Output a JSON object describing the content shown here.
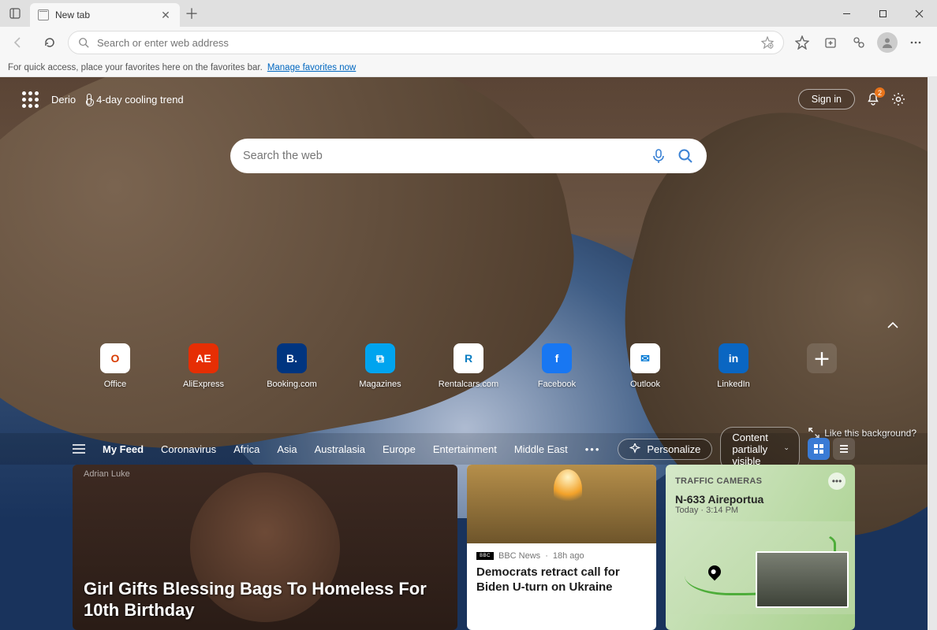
{
  "tab": {
    "title": "New tab"
  },
  "addressbar": {
    "placeholder": "Search or enter web address"
  },
  "favorites_bar": {
    "hint": "For quick access, place your favorites here on the favorites bar.",
    "link": "Manage favorites now"
  },
  "ntp_header": {
    "location": "Derio",
    "weather": "4-day cooling trend",
    "signin": "Sign in",
    "notification_count": "2"
  },
  "ntp_search": {
    "placeholder": "Search the web"
  },
  "tiles": [
    {
      "label": "Office",
      "bg": "#ffffff",
      "fg": "#d83b01",
      "glyph": "O"
    },
    {
      "label": "AliExpress",
      "bg": "#e62e04",
      "fg": "#ffffff",
      "glyph": "AE"
    },
    {
      "label": "Booking.com",
      "bg": "#003580",
      "fg": "#ffffff",
      "glyph": "B."
    },
    {
      "label": "Magazines",
      "bg": "#00a4ef",
      "fg": "#ffffff",
      "glyph": "⧉"
    },
    {
      "label": "Rentalcars.com",
      "bg": "#ffffff",
      "fg": "#0a7cc2",
      "glyph": "R"
    },
    {
      "label": "Facebook",
      "bg": "#1877f2",
      "fg": "#ffffff",
      "glyph": "f"
    },
    {
      "label": "Outlook",
      "bg": "#ffffff",
      "fg": "#0078d4",
      "glyph": "✉"
    },
    {
      "label": "LinkedIn",
      "bg": "#0a66c2",
      "fg": "#ffffff",
      "glyph": "in"
    }
  ],
  "like_bg": "Like this background?",
  "feed_nav": {
    "myfeed": "My Feed",
    "tabs": [
      "Coronavirus",
      "Africa",
      "Asia",
      "Australasia",
      "Europe",
      "Entertainment",
      "Middle East"
    ],
    "personalize": "Personalize",
    "visibility": "Content partially visible"
  },
  "cards": {
    "big": {
      "credit": "Adrian Luke",
      "headline": "Girl Gifts Blessing Bags To Homeless For 10th Birthday"
    },
    "mid": {
      "source": "BBC News",
      "age": "18h ago",
      "headline": "Democrats retract call for Biden U-turn on Ukraine"
    },
    "side": {
      "title": "TRAFFIC CAMERAS",
      "location": "N-633 Aireportua",
      "timestamp": "Today · 3:14 PM"
    }
  }
}
